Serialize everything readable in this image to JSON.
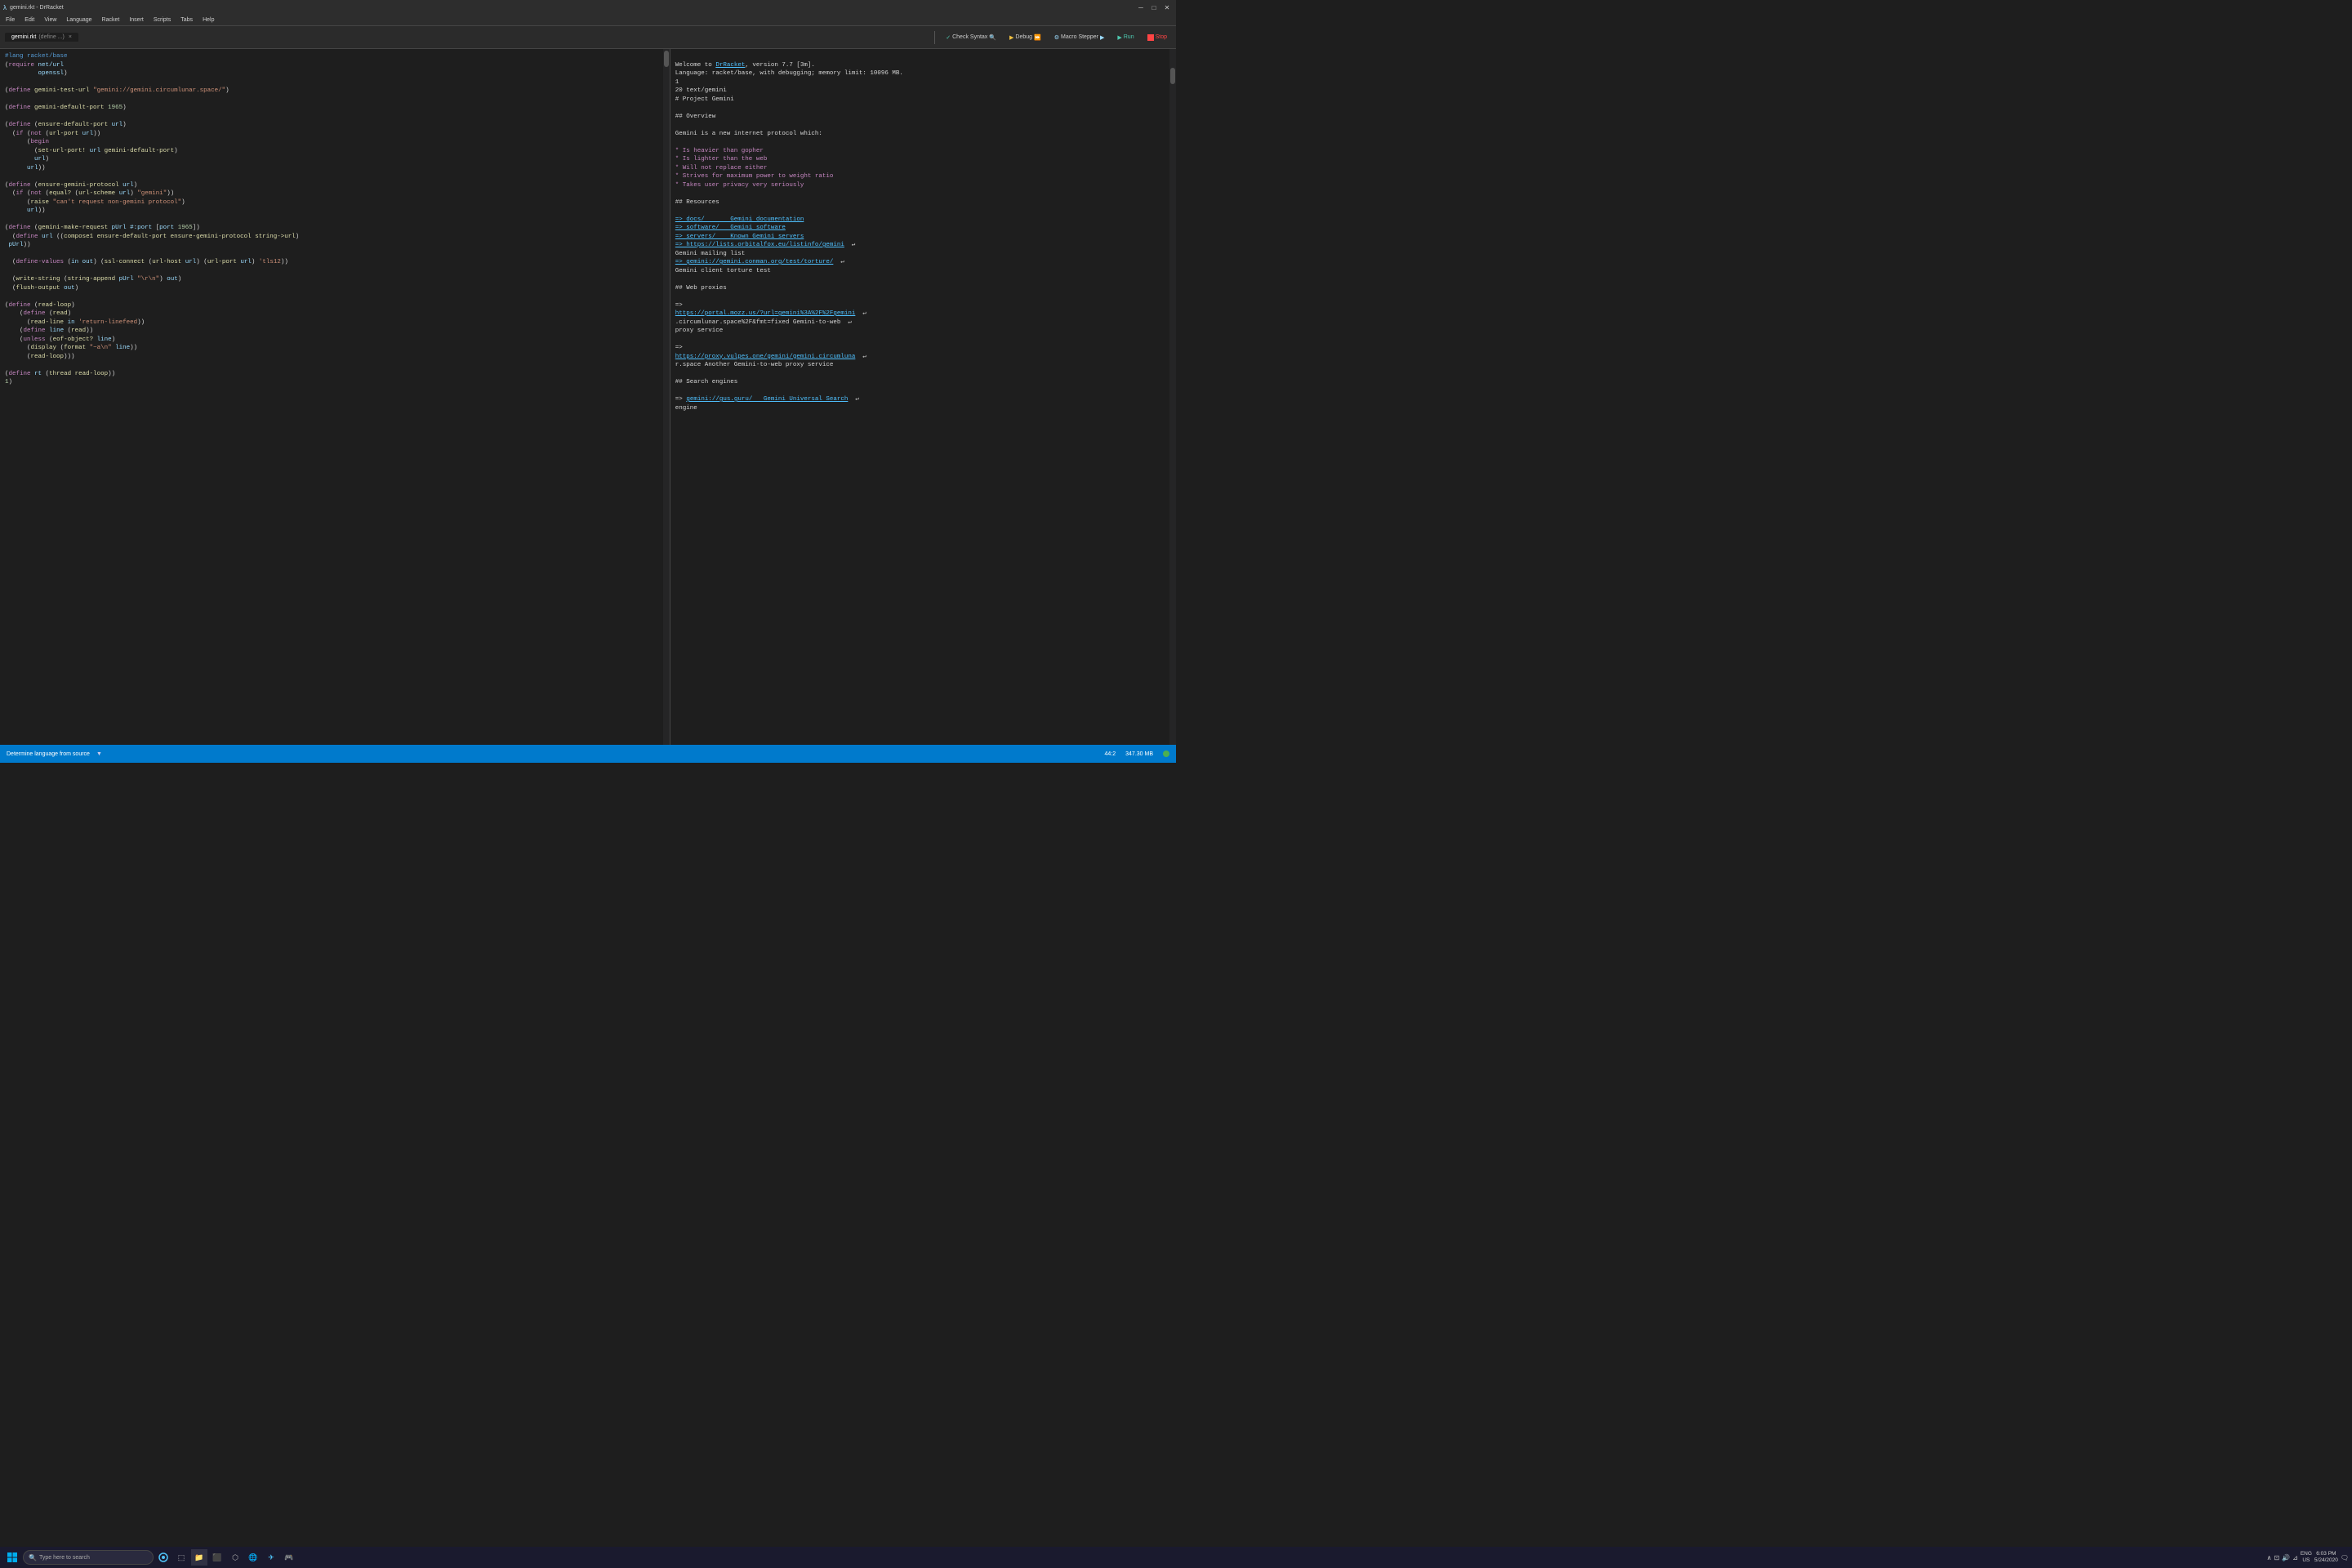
{
  "app": {
    "title": "gemini.rkt - DrRacket",
    "icon": "λ"
  },
  "titlebar": {
    "title": "gemini.rkt - DrRacket",
    "minimize": "─",
    "maximize": "□",
    "close": "✕"
  },
  "menubar": {
    "items": [
      "File",
      "Edit",
      "View",
      "Language",
      "Racket",
      "Insert",
      "Scripts",
      "Tabs",
      "Help"
    ]
  },
  "toolbar": {
    "tab1_label": "gemini.rkt",
    "tab1_sub": "(define ...)",
    "check_syntax": "Check Syntax",
    "debug": "Debug",
    "macro_stepper": "Macro Stepper",
    "run": "Run",
    "stop": "Stop"
  },
  "editor": {
    "code": "#lang racket/base\n(require net/url\n         openssl)\n\n(define gemini-test-url \"gemini://gemini.circumlunar.space/\")\n\n(define gemini-default-port 1965)\n\n(define (ensure-default-port url)\n  (if (not (url-port url))\n      (begin\n        (set-url-port! url gemini-default-port)\n        url)\n      url))\n\n(define (ensure-gemini-protocol url)\n  (if (not (equal? (url-scheme url) \"gemini\"))\n      (raise \"can't request non-gemini protocol\")\n      url))\n\n(define (gemini-make-request pUrl #:port [port 1965])\n  (define url ((compose1 ensure-default-port ensure-gemini-protocol string->url)\n pUrl))\n\n  (define-values (in out) (ssl-connect (url-host url) (url-port url) 'tls12))\n\n  (write-string (string-append pUrl \"\\r\\n\") out)\n  (flush-output out)\n\n(define (read-loop)\n    (define (read)\n      (read-line in 'return-linefeed))\n    (define line (read))\n    (unless (eof-object? line)\n      (display (format \"~a\\n\" line))\n      (read-loop)))\n\n(define rt (thread read-loop))\n1)"
  },
  "output": {
    "welcome_line1": "Welcome to DrRacket, version 7.7 [3m].",
    "welcome_drracket": "DrRacket",
    "language_line": "Language: racket/base, with debugging; memory limit: 10096 MB.",
    "number_1": "1",
    "gemini_path": "20 text/gemini",
    "heading1": "# Project Gemini",
    "blank1": "",
    "overview": "## Overview",
    "blank2": "",
    "intro": "Gemini is a new internet protocol which:",
    "blank3": "",
    "bullet1": "* Is heavier than gopher",
    "bullet2": "* Is lighter than the web",
    "bullet3": "* Will not replace either",
    "bullet4": "* Strives for maximum power to weight ratio",
    "bullet5": "* Takes user privacy very seriously",
    "blank4": "",
    "resources": "## Resources",
    "blank5": "",
    "link1": "=> docs/       Gemini documentation",
    "link2": "=> software/   Gemini software",
    "link3": "=> servers/    Known Gemini servers",
    "link4_url": "=> https://lists.orbitalfox.eu/listinfo/gemini",
    "link4_text": "Gemini mailing list",
    "link5_url": "=> gemini://gemini.conman.org/test/torture/",
    "link5_text": "Gemini client torture test",
    "blank6": "",
    "webproxies": "## Web proxies",
    "blank7": "",
    "link6_arrow": "=>",
    "link6_url": "https://portal.mozz.us/?url=gemini%3A%2F%2Fgemini.circumlunar.space%2F&fmt=fixed",
    "link6_text": "Gemini-to-web proxy service",
    "blank8": "",
    "link7_arrow": "=>",
    "link7_url": "https://proxy.vulpes.one/gemini/gemini.circumlunar.space",
    "link7_text": "Another Gemini-to-web proxy service",
    "blank9": "",
    "search_engines": "## Search engines",
    "blank10": "",
    "link8_arrow": "=>",
    "link8_url": "gemini://gus.guru/",
    "link8_text": "Gemini Universal Search",
    "engine_text": "engine"
  },
  "statusbar": {
    "language": "Determine language from source",
    "position": "44:2",
    "memory": "347.30 MB"
  },
  "taskbar": {
    "search_placeholder": "Type here to search",
    "time": "6:03 PM",
    "date": "5/24/2020",
    "lang": "ENG",
    "region": "US"
  }
}
